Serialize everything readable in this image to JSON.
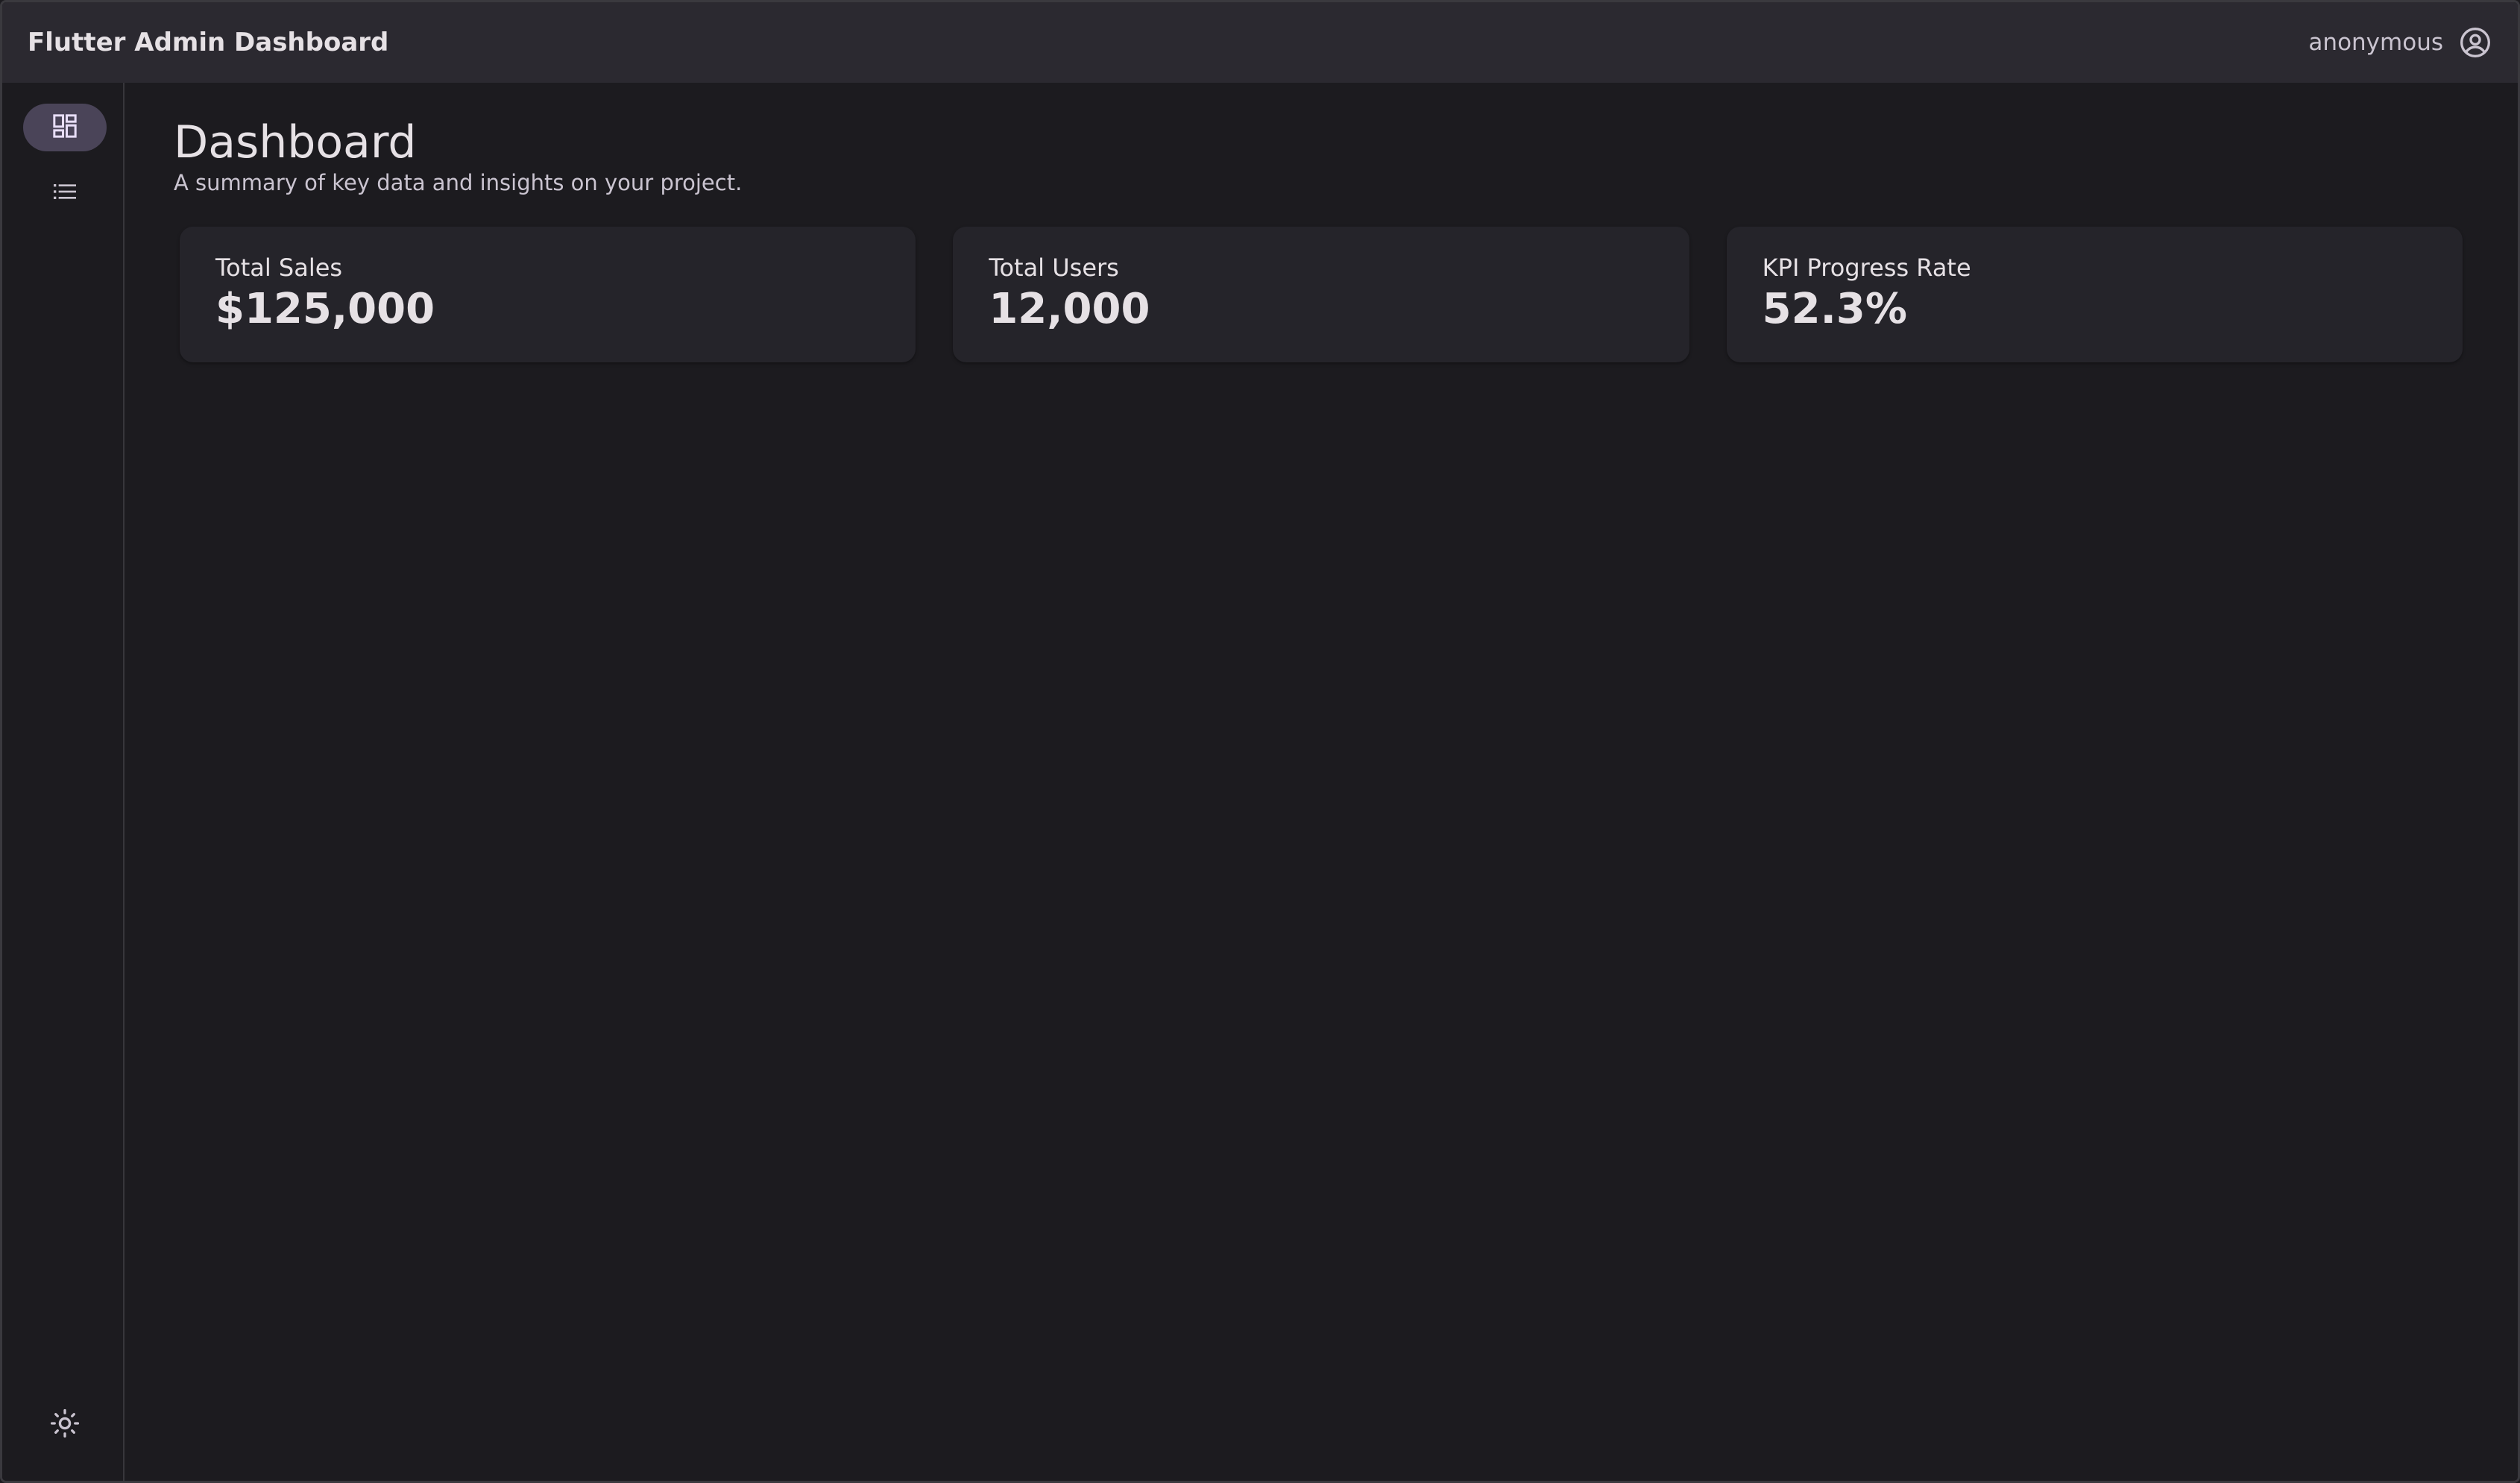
{
  "appbar": {
    "title": "Flutter Admin Dashboard",
    "username": "anonymous",
    "account_icon": "account-circle-icon"
  },
  "rail": {
    "items": [
      {
        "icon": "dashboard-icon",
        "active": true
      },
      {
        "icon": "list-icon",
        "active": false
      }
    ],
    "theme_icon": "light-mode-icon"
  },
  "page": {
    "title": "Dashboard",
    "subtitle": "A summary of key data and insights on your project."
  },
  "cards": [
    {
      "label": "Total Sales",
      "value": "$125,000"
    },
    {
      "label": "Total Users",
      "value": "12,000"
    },
    {
      "label": "KPI Progress Rate",
      "value": "52.3%"
    }
  ],
  "colors": {
    "background": "#1c1b1f",
    "appbar": "#2b2930",
    "card": "#25242a",
    "rail_active": "#4a4458"
  }
}
